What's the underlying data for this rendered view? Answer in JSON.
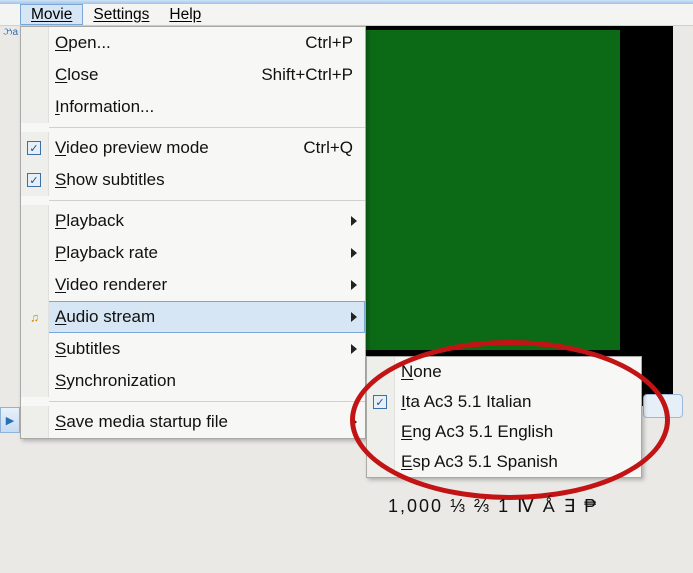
{
  "menubar": {
    "items": [
      {
        "label": "Movie",
        "active": true
      },
      {
        "label": "Settings",
        "active": false
      },
      {
        "label": "Help",
        "active": false
      }
    ]
  },
  "movie_menu": {
    "open": {
      "label": "Open...",
      "mnemonic": "O",
      "shortcut": "Ctrl+P"
    },
    "close": {
      "label": "Close",
      "mnemonic": "C",
      "shortcut": "Shift+Ctrl+P"
    },
    "information": {
      "label": "Information...",
      "mnemonic": "I"
    },
    "video_preview": {
      "label": "Video preview mode",
      "mnemonic": "V",
      "shortcut": "Ctrl+Q",
      "checked": true
    },
    "show_subtitles": {
      "label": "Show subtitles",
      "mnemonic": "S",
      "checked": true
    },
    "playback": {
      "label": "Playback",
      "mnemonic": "P",
      "submenu": true
    },
    "playback_rate": {
      "label": "Playback rate",
      "mnemonic": "P",
      "submenu": true
    },
    "video_renderer": {
      "label": "Video renderer",
      "mnemonic": "V",
      "submenu": true
    },
    "audio_stream": {
      "label": "Audio stream",
      "mnemonic": "A",
      "submenu": true,
      "highlighted": true
    },
    "subtitles": {
      "label": "Subtitles",
      "mnemonic": "S",
      "submenu": true
    },
    "synchronization": {
      "label": "Synchronization",
      "mnemonic": "S"
    },
    "save_startup": {
      "label": "Save media startup file",
      "mnemonic": "S",
      "submenu": true
    }
  },
  "audio_stream_submenu": {
    "items": [
      {
        "label": "None",
        "mnemonic": "N",
        "checked": false
      },
      {
        "label": "Ita Ac3 5.1 Italian",
        "mnemonic": "I",
        "checked": true
      },
      {
        "label": "Eng Ac3 5.1 English",
        "mnemonic": "E",
        "checked": false
      },
      {
        "label": "Esp Ac3 5.1 Spanish",
        "mnemonic": "E",
        "checked": false
      }
    ]
  },
  "footer_text": "1,000 ⅓ ⅔ 1 Ⅳ Ǻ ∃ ₱"
}
